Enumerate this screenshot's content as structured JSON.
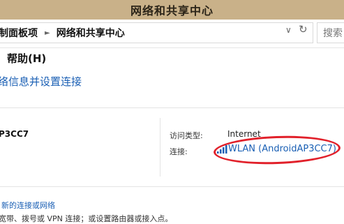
{
  "window": {
    "title": "网络和共享中心"
  },
  "address_bar": {
    "breadcrumbs": [
      "制面板项",
      "网络和共享中心"
    ],
    "search_placeholder": "搜索"
  },
  "menu": {
    "items": [
      "帮助(H)"
    ]
  },
  "main": {
    "heading": "络信息并设置连接"
  },
  "active_network": {
    "name": "P3CC7",
    "access_type_label": "访问类型:",
    "access_type_value": "Internet",
    "connections_label": "连接:",
    "connection_value": "WLAN (AndroidAP3CC7)"
  },
  "change_settings": {
    "new_connection_link": "新的连接或网络",
    "new_connection_desc": "宽带、拨号或 VPN 连接；或设置路由器或接入点。"
  },
  "colors": {
    "titlebar": "#c9b189",
    "link": "#1a5fb4",
    "highlight": "#e1202a"
  }
}
